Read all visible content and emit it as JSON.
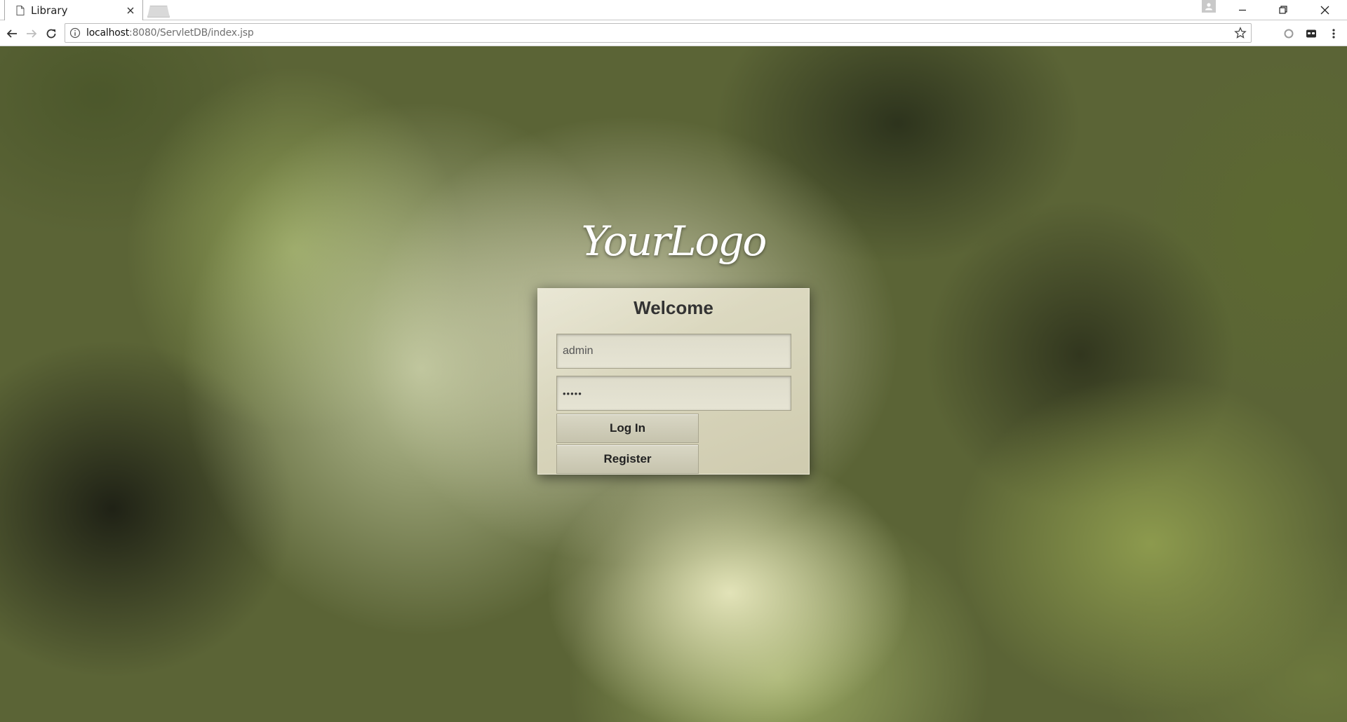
{
  "browser": {
    "tab_title": "Library",
    "url_host": "localhost",
    "url_rest": ":8080/ServletDB/index.jsp"
  },
  "page": {
    "logo_text": "YourLogo",
    "title": "Welcome",
    "username_value": "admin",
    "password_value": "•••••",
    "login_label": "Log In",
    "register_label": "Register"
  },
  "icons": {
    "tab": [
      "page-icon",
      "close-icon",
      "new-tab-button"
    ],
    "window": [
      "profile-icon",
      "minimize-icon",
      "restore-icon",
      "close-window-icon"
    ],
    "toolbar": [
      "back-arrow-icon",
      "forward-arrow-icon",
      "reload-icon",
      "info-icon",
      "star-icon",
      "extension-circle-icon",
      "extension-mask-icon",
      "menu-dots-icon"
    ]
  }
}
